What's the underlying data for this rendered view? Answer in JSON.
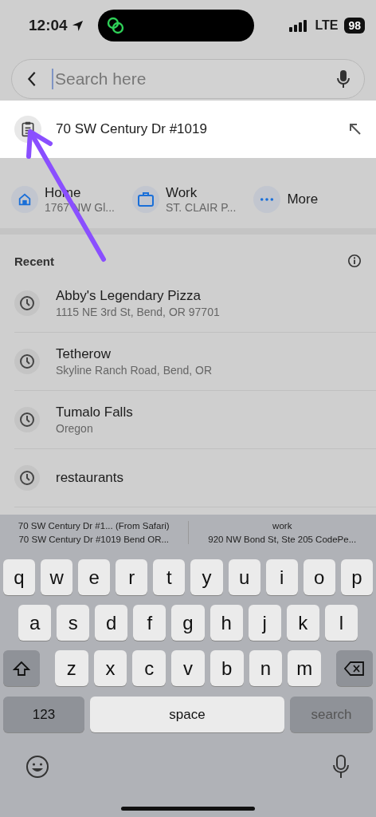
{
  "status_bar": {
    "time": "12:04",
    "network": "LTE",
    "battery": "98"
  },
  "search": {
    "placeholder": "Search here"
  },
  "clipboard": {
    "text": "70 SW Century Dr #1019"
  },
  "shortcuts": [
    {
      "kind": "home",
      "label": "Home",
      "subtitle": "1767 NW Gl..."
    },
    {
      "kind": "work",
      "label": "Work",
      "subtitle": "ST. CLAIR P..."
    },
    {
      "kind": "more",
      "label": "More"
    }
  ],
  "recent": {
    "title": "Recent",
    "items": [
      {
        "title": "Abby's Legendary Pizza",
        "subtitle": "1115 NE 3rd St, Bend, OR 97701"
      },
      {
        "title": "Tetherow",
        "subtitle": "Skyline Ranch Road, Bend, OR"
      },
      {
        "title": "Tumalo Falls",
        "subtitle": "Oregon"
      },
      {
        "title": "restaurants"
      }
    ]
  },
  "keyboard": {
    "suggestions": [
      {
        "title": "70 SW Century Dr #1... (From Safari)",
        "detail": "70 SW Century Dr #1019 Bend OR..."
      },
      {
        "title": "work",
        "detail": "920 NW Bond St, Ste 205 CodePe..."
      }
    ],
    "rows": [
      [
        "q",
        "w",
        "e",
        "r",
        "t",
        "y",
        "u",
        "i",
        "o",
        "p"
      ],
      [
        "a",
        "s",
        "d",
        "f",
        "g",
        "h",
        "j",
        "k",
        "l"
      ],
      [
        "z",
        "x",
        "c",
        "v",
        "b",
        "n",
        "m"
      ]
    ],
    "numbers_key": "123",
    "space_key": "space",
    "return_key": {
      "label": "search",
      "disabled": true
    }
  }
}
